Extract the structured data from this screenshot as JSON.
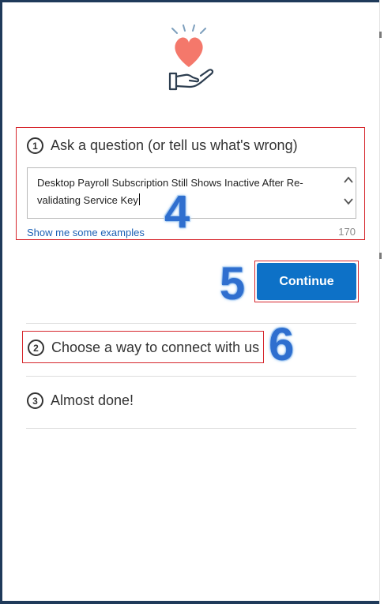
{
  "steps": [
    {
      "number": "1",
      "title": "Ask a question (or tell us what's wrong)"
    },
    {
      "number": "2",
      "title": "Choose a way to connect with us"
    },
    {
      "number": "3",
      "title": "Almost done!"
    }
  ],
  "question": {
    "value": "Desktop Payroll Subscription Still Shows Inactive After Re-validating Service Key",
    "line1": "Desktop Payroll Subscription Still Shows Inactive After Re-",
    "line2": "validating Service Key",
    "examples_link": "Show me some examples",
    "char_count": "170"
  },
  "continue_button": {
    "label": "Continue"
  },
  "annotations": [
    "4",
    "5",
    "6"
  ],
  "colors": {
    "primary": "#0d71c7",
    "highlight_border": "#d6262c",
    "heart": "#f4786b",
    "link": "#1a5fb4",
    "frame": "#1f3a5a"
  },
  "icons": {
    "logo": "heart-in-hand-icon",
    "scroll_up": "chevron-up-icon",
    "scroll_down": "chevron-down-icon"
  }
}
